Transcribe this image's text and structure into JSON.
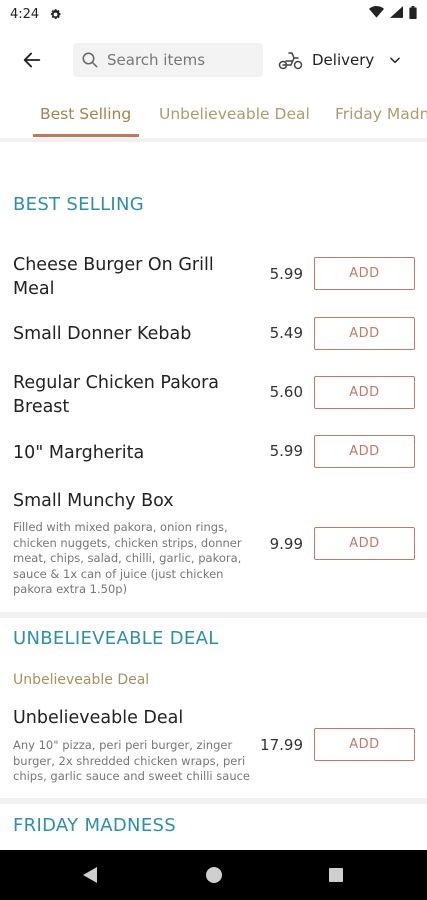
{
  "status_bar": {
    "time": "4:24"
  },
  "header": {
    "search_placeholder": "Search items",
    "delivery_label": "Delivery"
  },
  "tabs": [
    {
      "label": "Best Selling"
    },
    {
      "label": "Unbelieveable Deal"
    },
    {
      "label": "Friday Madness"
    }
  ],
  "sections": [
    {
      "title": "BEST SELLING",
      "items": [
        {
          "name_line1": "Cheese Burger On Grill",
          "name_line2": "Meal",
          "price": "5.99",
          "add_label": "ADD"
        },
        {
          "name_line1": "Small Donner Kebab",
          "price": "5.49",
          "add_label": "ADD"
        },
        {
          "name_line1": "Regular Chicken Pakora",
          "name_line2": "Breast",
          "price": "5.60",
          "add_label": "ADD"
        },
        {
          "name_line1": "10\" Margherita",
          "price": "5.99",
          "add_label": "ADD"
        },
        {
          "name_line1": "Small Munchy Box",
          "description": "Filled with mixed pakora, onion rings, chicken nuggets, chicken strips, donner meat, chips, salad, chilli, garlic, pakora, sauce & 1x can of juice (just chicken pakora extra 1.50p)",
          "price": "9.99",
          "add_label": "ADD"
        }
      ]
    },
    {
      "title": "UNBELIEVEABLE DEAL",
      "subtitle": "Unbelieveable Deal",
      "items": [
        {
          "name_line1": "Unbelieveable Deal",
          "description": "Any 10\" pizza, peri peri burger, zinger burger, 2x shredded chicken wraps, peri chips, garlic sauce and sweet chilli sauce",
          "price": "17.99",
          "add_label": "ADD"
        }
      ]
    },
    {
      "title": "FRIDAY MADNESS"
    }
  ],
  "colors": {
    "section_title": "#2f8fa8",
    "accent": "#c27a68",
    "tab_text": "#b09a6e"
  }
}
